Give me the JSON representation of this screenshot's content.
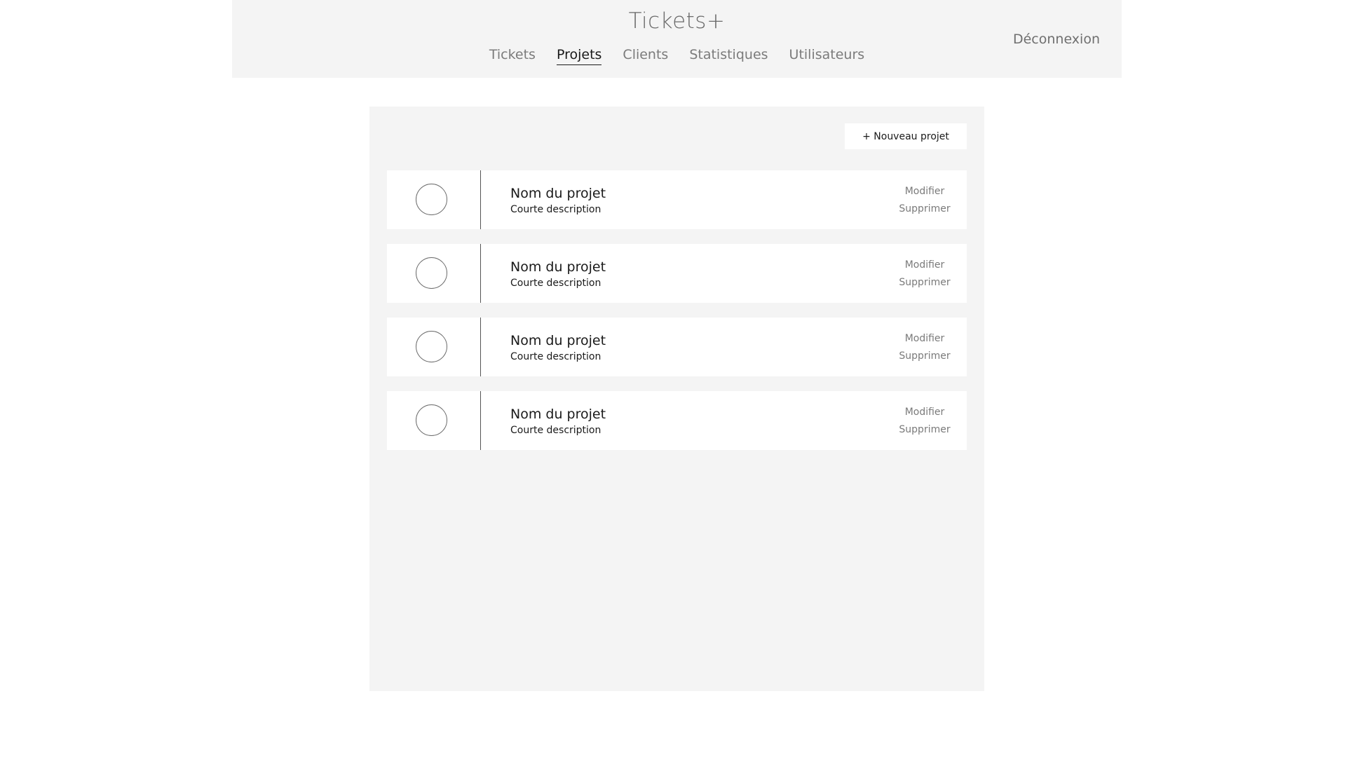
{
  "header": {
    "title": "Tickets+",
    "nav": [
      {
        "label": "Tickets",
        "active": false
      },
      {
        "label": "Projets",
        "active": true
      },
      {
        "label": "Clients",
        "active": false
      },
      {
        "label": "Statistiques",
        "active": false
      },
      {
        "label": "Utilisateurs",
        "active": false
      }
    ],
    "logout_label": "Déconnexion"
  },
  "main": {
    "new_project_label": "+ Nouveau projet",
    "projects": [
      {
        "name": "Nom du projet",
        "description": "Courte description",
        "edit_label": "Modifier",
        "delete_label": "Supprimer"
      },
      {
        "name": "Nom du projet",
        "description": "Courte description",
        "edit_label": "Modifier",
        "delete_label": "Supprimer"
      },
      {
        "name": "Nom du projet",
        "description": "Courte description",
        "edit_label": "Modifier",
        "delete_label": "Supprimer"
      },
      {
        "name": "Nom du projet",
        "description": "Courte description",
        "edit_label": "Modifier",
        "delete_label": "Supprimer"
      }
    ]
  }
}
